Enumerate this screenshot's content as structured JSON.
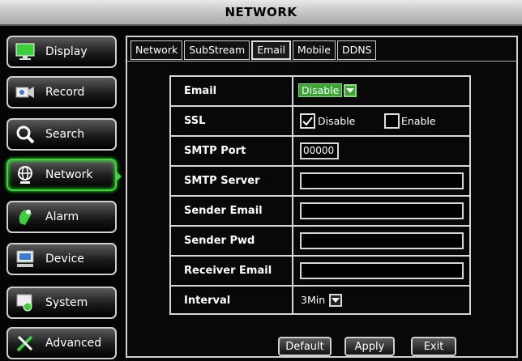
{
  "window": {
    "title": "NETWORK"
  },
  "sidebar": {
    "items": [
      {
        "label": "Display",
        "icon": "monitor-icon"
      },
      {
        "label": "Record",
        "icon": "camera-icon"
      },
      {
        "label": "Search",
        "icon": "magnifier-icon"
      },
      {
        "label": "Network",
        "icon": "globe-icon",
        "active": true
      },
      {
        "label": "Alarm",
        "icon": "alarm-icon"
      },
      {
        "label": "Device",
        "icon": "device-icon"
      },
      {
        "label": "System",
        "icon": "system-icon"
      },
      {
        "label": "Advanced",
        "icon": "tools-icon"
      }
    ]
  },
  "tabs": [
    {
      "label": "Network"
    },
    {
      "label": "SubStream"
    },
    {
      "label": "Email",
      "active": true
    },
    {
      "label": "Mobile"
    },
    {
      "label": "DDNS"
    }
  ],
  "form": {
    "email": {
      "label": "Email",
      "value": "Disable"
    },
    "ssl": {
      "label": "SSL",
      "disable_label": "Disable",
      "enable_label": "Enable",
      "disable_checked": true,
      "enable_checked": false
    },
    "smtp_port": {
      "label": "SMTP Port",
      "value": "00000"
    },
    "smtp_server": {
      "label": "SMTP Server",
      "value": ""
    },
    "sender_email": {
      "label": "Sender Email",
      "value": ""
    },
    "sender_pwd": {
      "label": "Sender Pwd",
      "value": ""
    },
    "receiver_email": {
      "label": "Receiver Email",
      "value": ""
    },
    "interval": {
      "label": "Interval",
      "value": "3Min"
    }
  },
  "buttons": {
    "default": "Default",
    "apply": "Apply",
    "exit": "Exit"
  },
  "colors": {
    "accent_green": "#3ad33a",
    "select_green": "#3aa534"
  }
}
